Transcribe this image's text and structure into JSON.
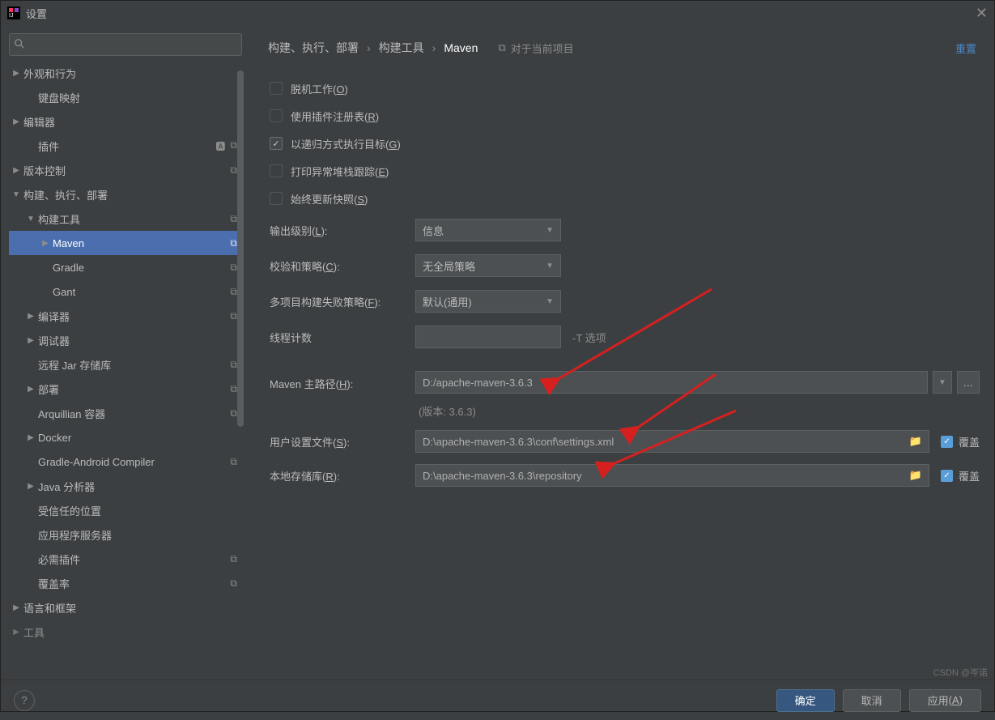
{
  "title": "设置",
  "sidebar": {
    "search_placeholder": "",
    "groups": {
      "appearance": "外观和行为",
      "keymap": "键盘映射",
      "editor": "编辑器",
      "plugins": "插件",
      "vcs": "版本控制",
      "build": "构建、执行、部署",
      "build_tools": "构建工具",
      "maven": "Maven",
      "gradle": "Gradle",
      "gant": "Gant",
      "compiler": "编译器",
      "debugger": "调试器",
      "remote_jar": "远程 Jar 存储库",
      "deployment": "部署",
      "arquillian": "Arquillian 容器",
      "docker": "Docker",
      "gradle_android": "Gradle-Android Compiler",
      "java_analyzer": "Java 分析器",
      "trusted": "受信任的位置",
      "app_servers": "应用程序服务器",
      "req_plugins": "必需插件",
      "coverage": "覆盖率",
      "langs": "语言和框架",
      "tools_cut": "工具"
    }
  },
  "breadcrumb": {
    "p1": "构建、执行、部署",
    "p2": "构建工具",
    "p3": "Maven"
  },
  "scope_label": "对于当前项目",
  "reset": "重置",
  "checks": {
    "offline": "脱机工作",
    "offline_mn": "O",
    "plugin_reg": "使用插件注册表",
    "plugin_reg_mn": "R",
    "recursive": "以递归方式执行目标",
    "recursive_mn": "G",
    "stacktrace": "打印异常堆栈跟踪",
    "stacktrace_mn": "E",
    "snapshots": "始终更新快照",
    "snapshots_mn": "S"
  },
  "fields": {
    "output_level": "输出级别",
    "output_level_mn": "L",
    "output_level_val": "信息",
    "checksum": "校验和策略",
    "checksum_mn": "C",
    "checksum_val": "无全局策略",
    "multi_fail": "多项目构建失败策略",
    "multi_fail_mn": "F",
    "multi_fail_val": "默认(通用)",
    "threads": "线程计数",
    "threads_hint": "-T 选项",
    "threads_val": "",
    "maven_home": "Maven 主路径",
    "maven_home_mn": "H",
    "maven_home_val": "D:/apache-maven-3.6.3",
    "version_label": "(版本: 3.6.3)",
    "user_settings": "用户设置文件",
    "user_settings_mn": "S",
    "user_settings_val": "D:\\apache-maven-3.6.3\\conf\\settings.xml",
    "local_repo": "本地存储库",
    "local_repo_mn": "R",
    "local_repo_val": "D:\\apache-maven-3.6.3\\repository",
    "override": "覆盖"
  },
  "buttons": {
    "ok": "确定",
    "cancel": "取消",
    "apply_label": "应用",
    "apply_mn": "A"
  },
  "watermark": "CSDN @岑诺"
}
